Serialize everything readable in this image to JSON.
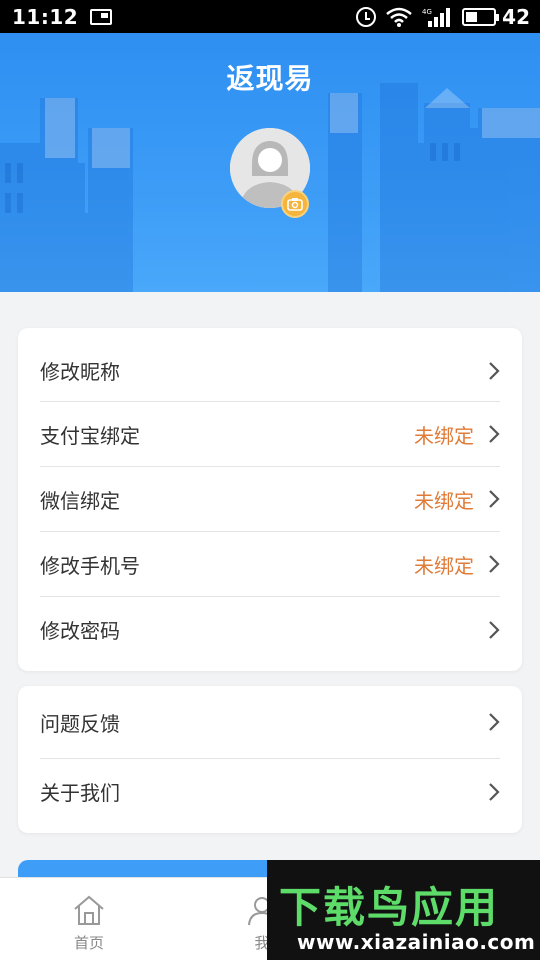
{
  "status_bar": {
    "time": "11:12",
    "battery_level": "42",
    "network": "4G"
  },
  "header": {
    "app_logo": "返现易"
  },
  "profile": {
    "avatar": "default-female-avatar",
    "camera_icon": "camera-icon"
  },
  "settings_group_1": [
    {
      "label": "修改昵称",
      "status": ""
    },
    {
      "label": "支付宝绑定",
      "status": "未绑定"
    },
    {
      "label": "微信绑定",
      "status": "未绑定"
    },
    {
      "label": "修改手机号",
      "status": "未绑定"
    },
    {
      "label": "修改密码",
      "status": ""
    }
  ],
  "settings_group_2": [
    {
      "label": "问题反馈"
    },
    {
      "label": "关于我们"
    }
  ],
  "bottom_nav": {
    "home_label": "首页",
    "me_label": "我"
  },
  "watermark": {
    "title": "下载鸟应用",
    "url": "www.xiazainiao.com"
  },
  "colors": {
    "header_blue": "#3c9cf6",
    "status_orange": "#e07b38",
    "camera_badge": "#f5b43b"
  }
}
